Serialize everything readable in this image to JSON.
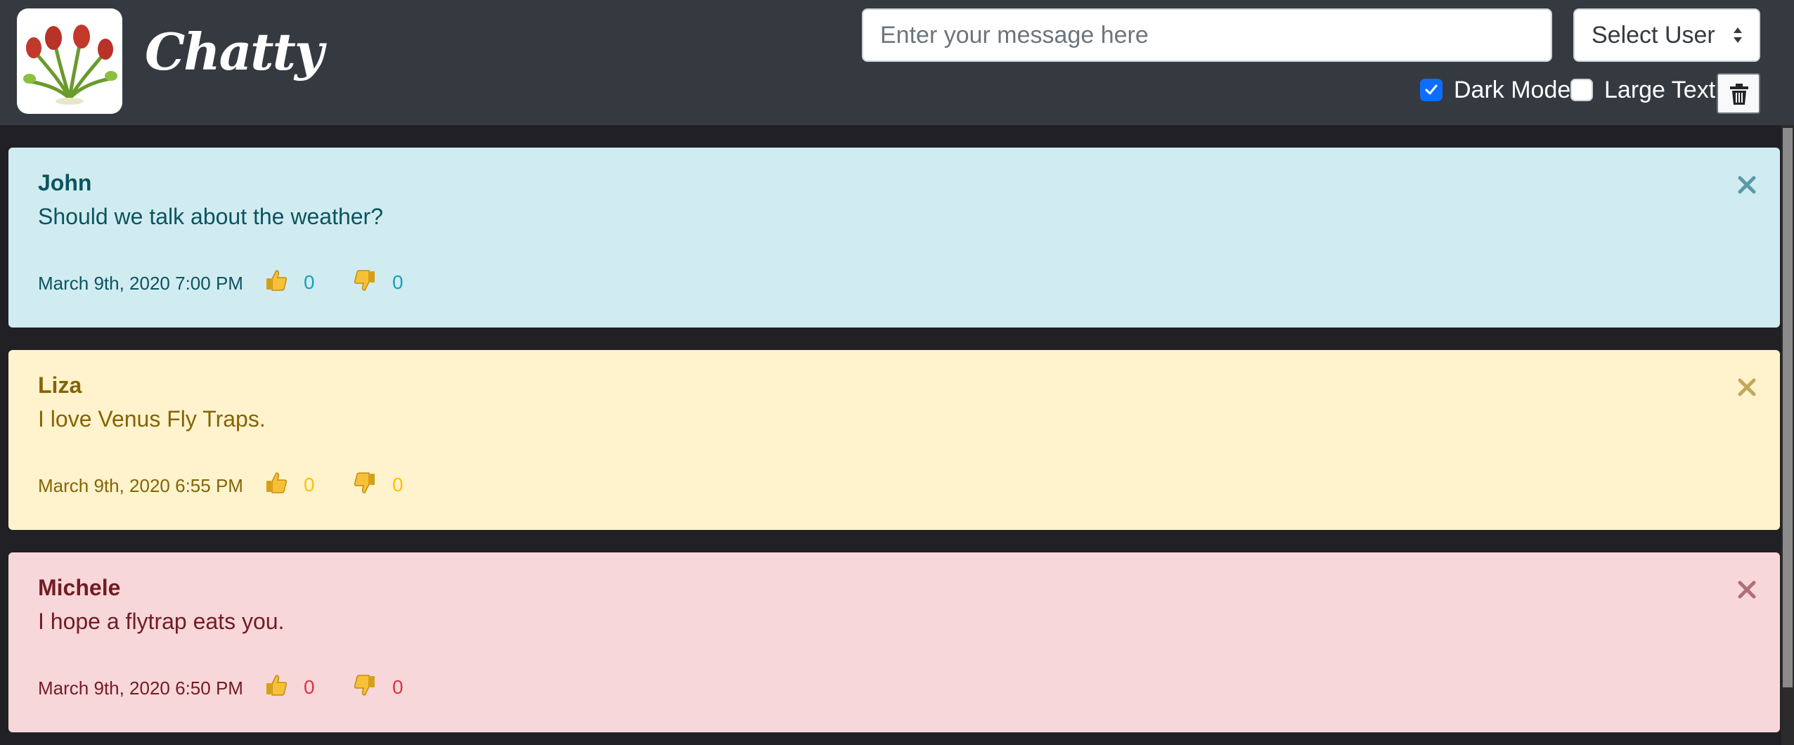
{
  "app": {
    "brand": "Chatty"
  },
  "header": {
    "message_input": {
      "placeholder": "Enter your message here",
      "value": ""
    },
    "user_select": {
      "selected": "Select User"
    },
    "dark_mode": {
      "label": "Dark Mode",
      "checked": true
    },
    "large_text": {
      "label": "Large Text",
      "checked": false
    },
    "clear_icon": "trash-icon"
  },
  "messages": [
    {
      "author": "John",
      "text": "Should we talk about the weather?",
      "date": "March 9th, 2020 7:00 PM",
      "likes": "0",
      "dislikes": "0",
      "style": "info"
    },
    {
      "author": "Liza",
      "text": "I love Venus Fly Traps.",
      "date": "March 9th, 2020 6:55 PM",
      "likes": "0",
      "dislikes": "0",
      "style": "warning"
    },
    {
      "author": "Michele",
      "text": "I hope a flytrap eats you.",
      "date": "March 9th, 2020 6:50 PM",
      "likes": "0",
      "dislikes": "0",
      "style": "danger"
    }
  ],
  "colors": {
    "navbar": "#343a40",
    "background": "#212025",
    "info_bg": "#d1ecf1",
    "warning_bg": "#fff3cd",
    "danger_bg": "#f8d7da",
    "checkbox_accent": "#0d6efd"
  }
}
